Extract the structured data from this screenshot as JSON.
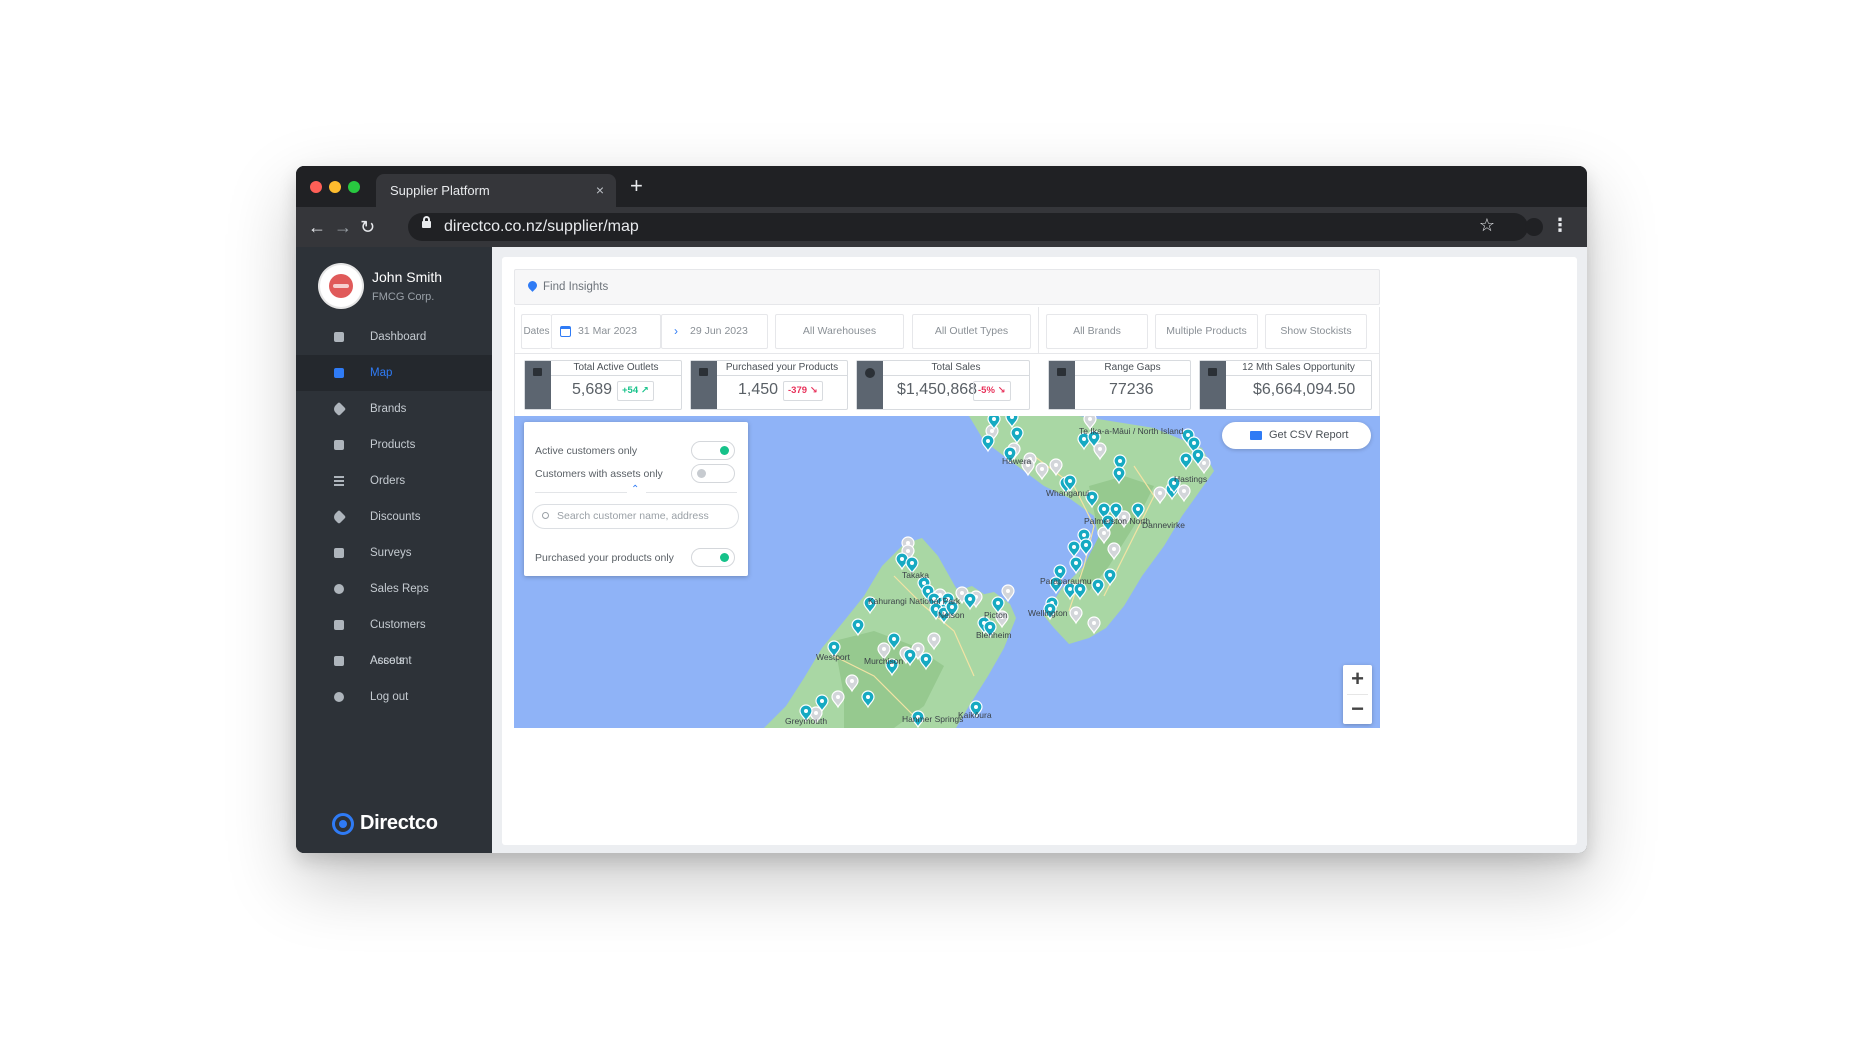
{
  "browser": {
    "tab_title": "Supplier Platform",
    "tab_close": "×",
    "new_tab": "+",
    "url": "directco.co.nz/supplier/map"
  },
  "user": {
    "name": "John Smith",
    "org": "FMCG Corp."
  },
  "sidebar": {
    "items": [
      {
        "label": "Dashboard",
        "icon": "dashboard-icon"
      },
      {
        "label": "Map",
        "icon": "map-icon",
        "active": true
      },
      {
        "label": "Brands",
        "icon": "tag-icon"
      },
      {
        "label": "Products",
        "icon": "basket-icon"
      },
      {
        "label": "Orders",
        "icon": "list-icon"
      },
      {
        "label": "Discounts",
        "icon": "discount-tag-icon"
      },
      {
        "label": "Surveys",
        "icon": "checkbox-icon"
      },
      {
        "label": "Sales Reps",
        "icon": "person-icon"
      },
      {
        "label": "Customers",
        "icon": "store-icon"
      },
      {
        "label": "Assets",
        "icon": "document-icon"
      }
    ],
    "bottom": [
      {
        "label": "Account",
        "icon": "account-icon"
      },
      {
        "label": "Log out",
        "icon": "gear-icon"
      }
    ],
    "logo": "Directco"
  },
  "insights": {
    "title": "Find Insights",
    "dates_label": "Dates",
    "start_date": "31 Mar 2023",
    "end_date": "29 Jun 2023",
    "filters": [
      "All Warehouses",
      "All Outlet Types",
      "All Brands",
      "Multiple Products",
      "Show Stockists"
    ]
  },
  "stats": [
    {
      "label": "Total Active Outlets",
      "value": "5,689",
      "change": "+54",
      "trend": "up"
    },
    {
      "label": "Purchased your Products",
      "value": "1,450",
      "change": "-379",
      "trend": "down"
    },
    {
      "label": "Total Sales",
      "value": "$1,450,868",
      "change": "-5%",
      "trend": "down"
    },
    {
      "label": "Range Gaps",
      "value": "77236"
    },
    {
      "label": "12 Mth Sales Opportunity",
      "value": "$6,664,094.50"
    }
  ],
  "map_panel": {
    "active_only": {
      "label": "Active customers only",
      "on": true
    },
    "with_assets": {
      "label": "Customers with assets only",
      "on": false
    },
    "search_placeholder": "Search customer name, address",
    "purchased_only": {
      "label": "Purchased your products only",
      "on": true
    }
  },
  "csv_button": "Get CSV Report",
  "zoom": {
    "in": "+",
    "out": "−"
  },
  "map_labels": [
    "Te Ika-a-Māui / North Island",
    "Hastings",
    "Whanganui",
    "Dannevirke",
    "Palmerston North",
    "Paraparaumu",
    "Wellington",
    "Takaka",
    "Kahurangi National Park",
    "Nelson",
    "Picton",
    "Blenheim",
    "Westport",
    "Murchison",
    "Greymouth",
    "Hanmer Springs",
    "Kaikōura",
    "Hāwera"
  ],
  "colors": {
    "accent": "#2f7bf5",
    "positive": "#16c28a",
    "negative": "#e8315a",
    "sidebar": "#2d3238",
    "sea": "#8fb3f7",
    "land": "#a9d7a4",
    "marker": "#16aac2"
  }
}
